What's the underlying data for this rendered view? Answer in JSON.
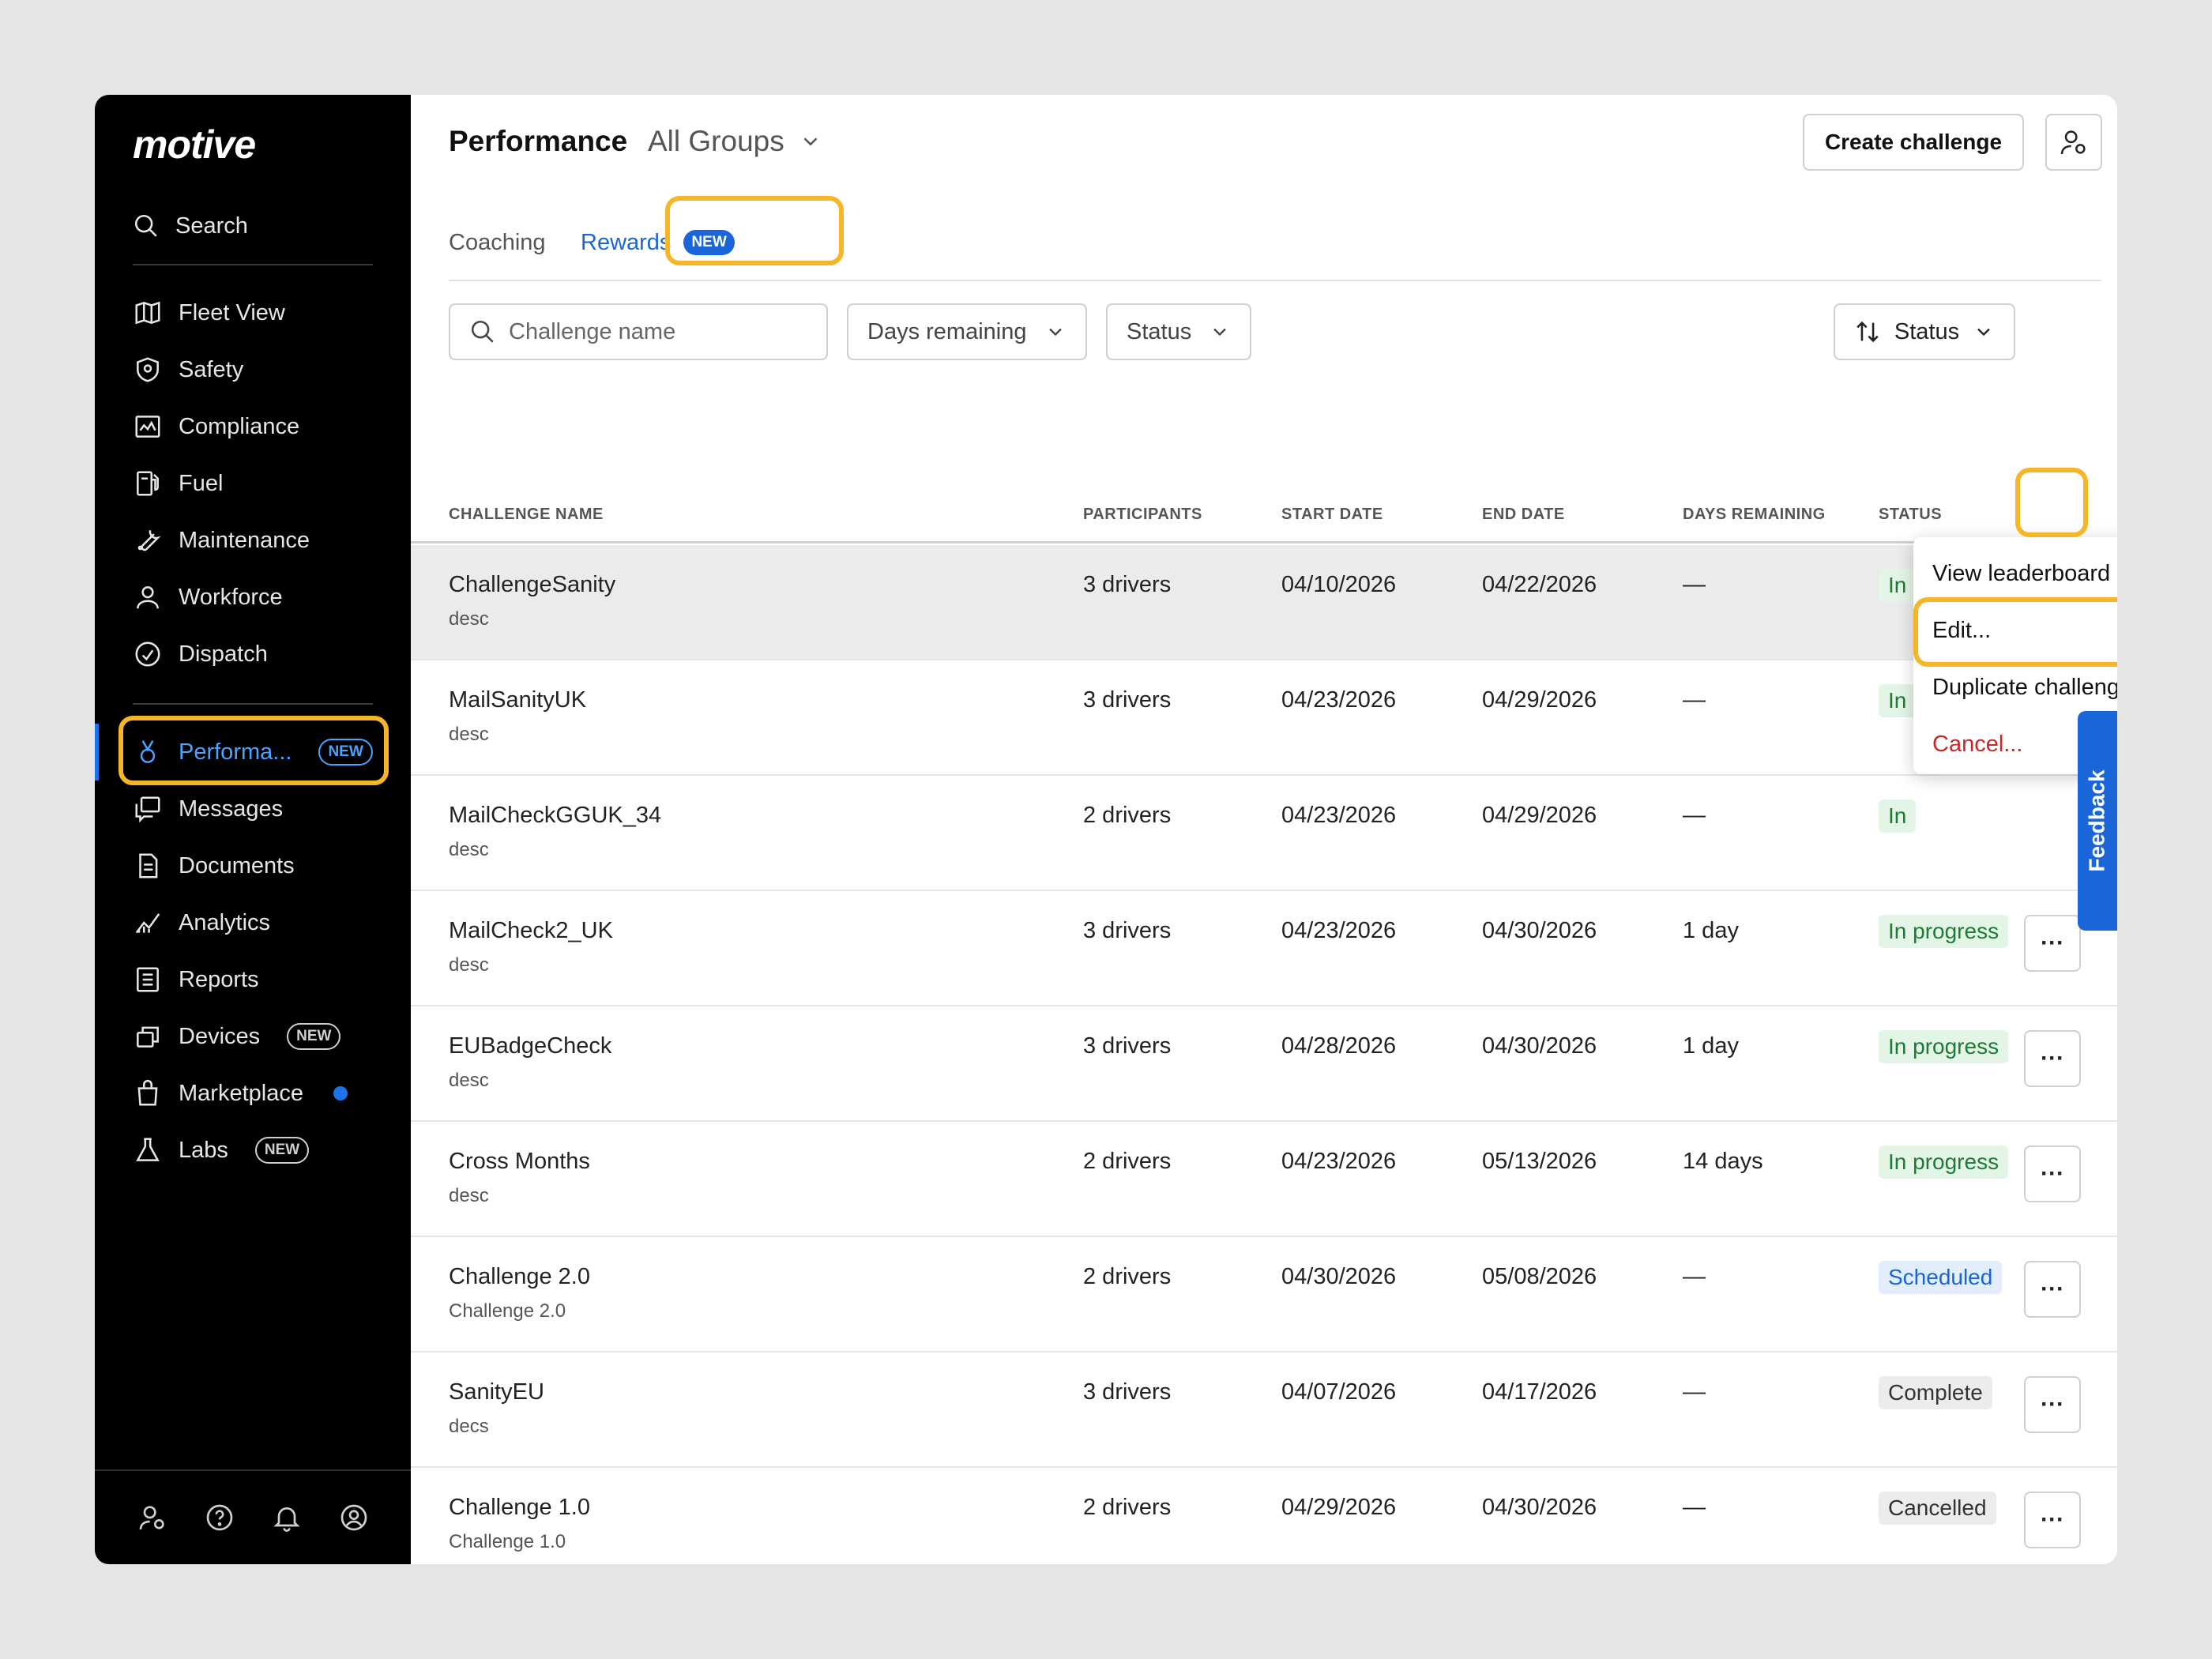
{
  "sidebar": {
    "logo": "motive",
    "search_label": "Search",
    "items": [
      {
        "label": "Fleet View",
        "icon": "map-icon"
      },
      {
        "label": "Safety",
        "icon": "shield-icon"
      },
      {
        "label": "Compliance",
        "icon": "compliance-icon"
      },
      {
        "label": "Fuel",
        "icon": "fuel-icon"
      },
      {
        "label": "Maintenance",
        "icon": "wrench-icon"
      },
      {
        "label": "Workforce",
        "icon": "person-icon"
      },
      {
        "label": "Dispatch",
        "icon": "dispatch-icon"
      }
    ],
    "items2": [
      {
        "label": "Performa...",
        "badge": "NEW",
        "icon": "medal-icon"
      },
      {
        "label": "Messages",
        "icon": "messages-icon"
      },
      {
        "label": "Documents",
        "icon": "document-icon"
      },
      {
        "label": "Analytics",
        "icon": "analytics-icon"
      },
      {
        "label": "Reports",
        "icon": "reports-icon"
      },
      {
        "label": "Devices",
        "badge": "NEW",
        "icon": "devices-icon"
      },
      {
        "label": "Marketplace",
        "icon": "bag-icon"
      },
      {
        "label": "Labs",
        "badge": "NEW",
        "icon": "flask-icon"
      }
    ],
    "bottom_icons": [
      "user-settings-icon",
      "help-icon",
      "bell-icon",
      "account-icon"
    ],
    "colors": {
      "background": "#000000",
      "active": "#4aa3ff",
      "highlight": "#f7b528"
    }
  },
  "header": {
    "title": "Performance",
    "group": "All Groups",
    "create_button": "Create challenge"
  },
  "tabs": [
    {
      "label": "Coaching"
    },
    {
      "label": "Rewards",
      "badge": "NEW"
    }
  ],
  "filters": {
    "search_placeholder": "Challenge name",
    "days": "Days remaining",
    "status": "Status",
    "sort": "Status"
  },
  "table": {
    "columns": [
      "CHALLENGE NAME",
      "PARTICIPANTS",
      "START DATE",
      "END DATE",
      "DAYS REMAINING",
      "STATUS"
    ],
    "rows": [
      {
        "name": "ChallengeSanity",
        "desc": "desc",
        "participants": "3 drivers",
        "start": "04/10/2026",
        "end": "04/22/2026",
        "days": "—",
        "status": "In progress"
      },
      {
        "name": "MailSanityUK",
        "desc": "desc",
        "participants": "3 drivers",
        "start": "04/23/2026",
        "end": "04/29/2026",
        "days": "—",
        "status": "In"
      },
      {
        "name": "MailCheckGGUK_34",
        "desc": "desc",
        "participants": "2 drivers",
        "start": "04/23/2026",
        "end": "04/29/2026",
        "days": "—",
        "status": "In"
      },
      {
        "name": "MailCheck2_UK",
        "desc": "desc",
        "participants": "3 drivers",
        "start": "04/23/2026",
        "end": "04/30/2026",
        "days": "1 day",
        "status": "In progress"
      },
      {
        "name": "EUBadgeCheck",
        "desc": "desc",
        "participants": "3 drivers",
        "start": "04/28/2026",
        "end": "04/30/2026",
        "days": "1 day",
        "status": "In progress"
      },
      {
        "name": "Cross Months",
        "desc": "desc",
        "participants": "2 drivers",
        "start": "04/23/2026",
        "end": "05/13/2026",
        "days": "14 days",
        "status": "In progress"
      },
      {
        "name": "Challenge 2.0",
        "desc": "Challenge 2.0",
        "participants": "2 drivers",
        "start": "04/30/2026",
        "end": "05/08/2026",
        "days": "—",
        "status": "Scheduled"
      },
      {
        "name": "SanityEU",
        "desc": "decs",
        "participants": "3 drivers",
        "start": "04/07/2026",
        "end": "04/17/2026",
        "days": "—",
        "status": "Complete"
      },
      {
        "name": "Challenge 1.0",
        "desc": "Challenge 1.0",
        "participants": "2 drivers",
        "start": "04/29/2026",
        "end": "04/30/2026",
        "days": "—",
        "status": "Cancelled"
      }
    ],
    "more_label": "···"
  },
  "menu": {
    "items": [
      "View leaderboard",
      "Edit...",
      "Duplicate challenge...",
      "Cancel..."
    ]
  },
  "feedback_label": "Feedback"
}
